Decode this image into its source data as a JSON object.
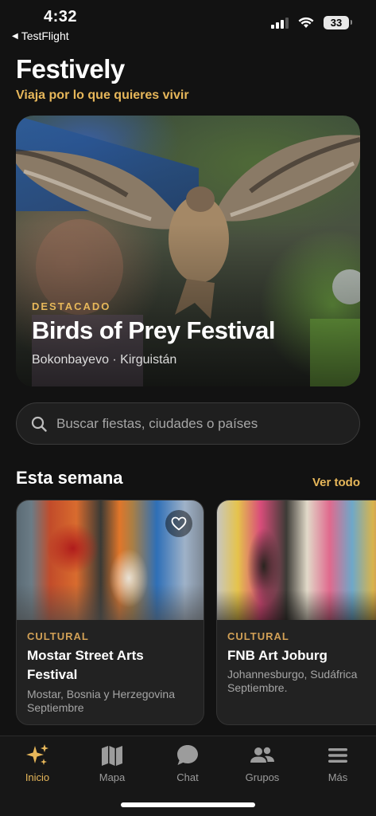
{
  "status_bar": {
    "time": "4:32",
    "back_app": "TestFlight",
    "battery": "33"
  },
  "header": {
    "title": "Festively",
    "subtitle": "Viaja por lo que quieres vivir"
  },
  "featured": {
    "badge": "DESTACADO",
    "title": "Birds of Prey Festival",
    "location": "Bokonbayevo · Kirguistán"
  },
  "search": {
    "placeholder": "Buscar fiestas, ciudades o países"
  },
  "section": {
    "title": "Esta semana",
    "see_all": "Ver todo"
  },
  "events": [
    {
      "category": "CULTURAL",
      "name": "Mostar Street Arts Festival",
      "place": "Mostar, Bosnia y Herzegovina",
      "month": "Septiembre"
    },
    {
      "category": "CULTURAL",
      "name": "FNB Art Joburg",
      "place": "Johannesburgo, Sudáfrica",
      "month": "Septiembre."
    }
  ],
  "tabs": [
    {
      "label": "Inicio",
      "icon": "sparkles-icon",
      "active": true
    },
    {
      "label": "Mapa",
      "icon": "map-icon"
    },
    {
      "label": "Chat",
      "icon": "chat-icon"
    },
    {
      "label": "Grupos",
      "icon": "groups-icon"
    },
    {
      "label": "Más",
      "icon": "menu-icon"
    }
  ],
  "colors": {
    "accent": "#e7b75a",
    "background": "#121212",
    "card": "#222222"
  }
}
